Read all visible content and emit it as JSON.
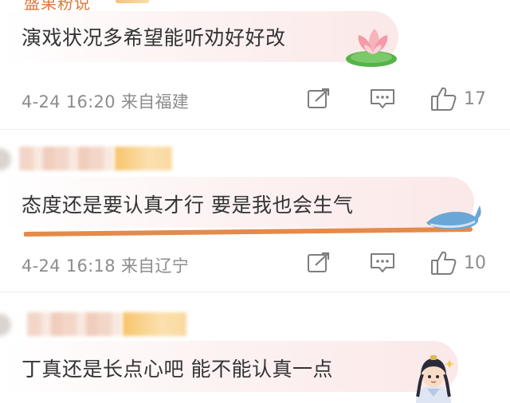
{
  "comments": [
    {
      "username": "盛果粉说",
      "text": "演戏状况多希望能听劝好好改",
      "date": "4-24",
      "time": "16:20",
      "location": "来自福建",
      "likes": "17",
      "sticker": "lotus-icon"
    },
    {
      "text": "态度还是要认真才行 要是我也会生气",
      "date": "4-24",
      "time": "16:18",
      "location": "来自辽宁",
      "likes": "10",
      "sticker": "whale-icon"
    },
    {
      "text": "丁真还是长点心吧 能不能认真一点",
      "sticker": "character-avatar-icon"
    }
  ],
  "icons": {
    "share": "share-icon",
    "reply": "comment-icon",
    "like": "thumbs-up-icon"
  },
  "colors": {
    "text": "#333333",
    "meta": "#8c8c8c",
    "accent_line": "#e58a4a",
    "bubble": "#fbe8e8"
  }
}
